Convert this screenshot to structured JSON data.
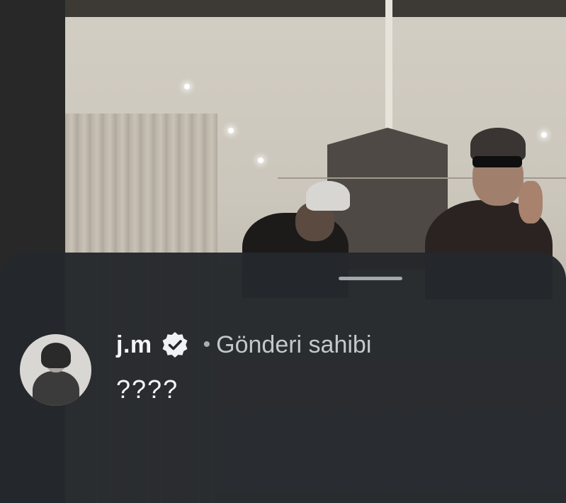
{
  "comment": {
    "username": "j.m",
    "verified_icon": "verified-badge-icon",
    "separator": "•",
    "author_label": "Gönderi sahibi",
    "text": "????"
  },
  "colors": {
    "sheet_background": "#24272c",
    "primary_text": "#f4f5f6",
    "secondary_text": "#c4c8cc",
    "handle": "#a4a8ad"
  }
}
